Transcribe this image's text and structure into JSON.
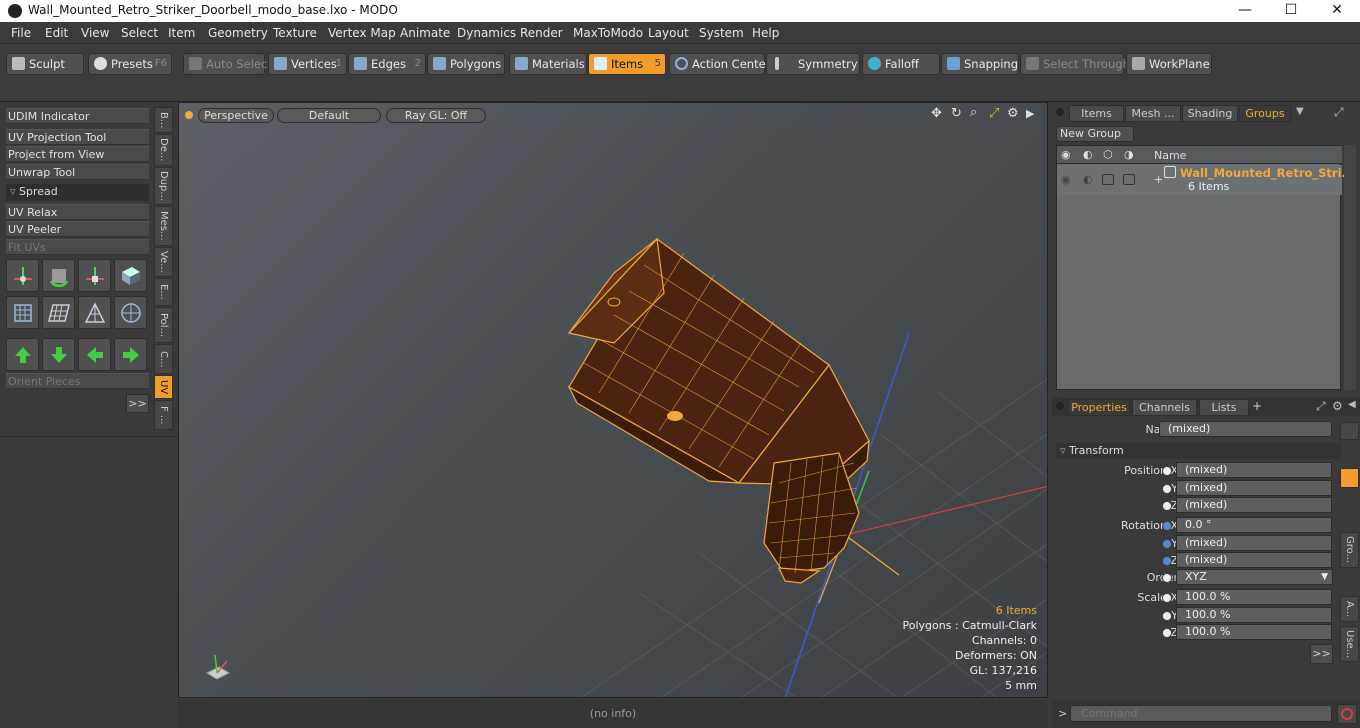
{
  "window": {
    "title": "Wall_Mounted_Retro_Striker_Doorbell_modo_base.lxo - MODO",
    "min": "—",
    "max": "☐",
    "close": "✕"
  },
  "menu": [
    "File",
    "Edit",
    "View",
    "Select",
    "Item",
    "Geometry",
    "Texture",
    "Vertex Map",
    "Animate",
    "Dynamics",
    "Render",
    "MaxToModo",
    "Layout",
    "System",
    "Help"
  ],
  "toolbar": {
    "sculpt": "Sculpt",
    "presets": "Presets",
    "presets_key": "F6",
    "auto_select": "Auto Select",
    "vertices": "Vertices",
    "vertices_key": "1",
    "edges": "Edges",
    "edges_key": "2",
    "polygons": "Polygons",
    "materials": "Materials",
    "items": "Items",
    "items_key": "5",
    "action_center": "Action Center",
    "symmetry": "Symmetry",
    "falloff": "Falloff",
    "snapping": "Snapping",
    "select_through": "Select Through",
    "workplane": "WorkPlane"
  },
  "left": {
    "items": [
      "UDIM Indicator",
      "UV Projection Tool",
      "Project from View",
      "Unwrap Tool"
    ],
    "spread": "Spread",
    "items2": [
      "UV Relax",
      "UV Peeler",
      "Fit UVs"
    ],
    "orient": "Orient Pieces",
    "more": ">>",
    "vtabs": [
      "B...",
      "De...",
      "Dup...",
      "Mes...",
      "Ve...",
      "E...",
      "Pol...",
      "C...",
      "UV",
      "F ..."
    ]
  },
  "viewport": {
    "view": "Perspective",
    "shading": "Default",
    "raygl": "Ray GL: Off",
    "stats": {
      "items": "6 Items",
      "polygons": "Polygons : Catmull-Clark",
      "channels": "Channels: 0",
      "deformers": "Deformers: ON",
      "gl": "GL: 137,216",
      "scale": "5 mm"
    }
  },
  "status": "(no info)",
  "right": {
    "tabs": [
      "Items",
      "Mesh ...",
      "Shading",
      "Groups"
    ],
    "new_group": "New Group",
    "col_name": "Name",
    "group_name": "Wall_Mounted_Retro_Stri...",
    "group_count": "6 Items",
    "prop_tabs": [
      "Properties",
      "Channels",
      "Lists",
      "+"
    ],
    "name_label": "Name",
    "name_value": "(mixed)",
    "transform": "Transform",
    "pos_label": "Position X",
    "rot_label": "Rotation X",
    "order_label": "Order",
    "scale_label": "Scale X",
    "y": "Y",
    "z": "Z",
    "pos": [
      "(mixed)",
      "(mixed)",
      "(mixed)"
    ],
    "rot": [
      "0.0 °",
      "(mixed)",
      "(mixed)"
    ],
    "order": "XYZ",
    "scale": [
      "100.0 %",
      "100.0 %",
      "100.0 %"
    ],
    "more": ">>",
    "vtabs": [
      "Gro...",
      "A...",
      "Use..."
    ]
  },
  "command": {
    "prompt": ">",
    "placeholder": "Command"
  }
}
